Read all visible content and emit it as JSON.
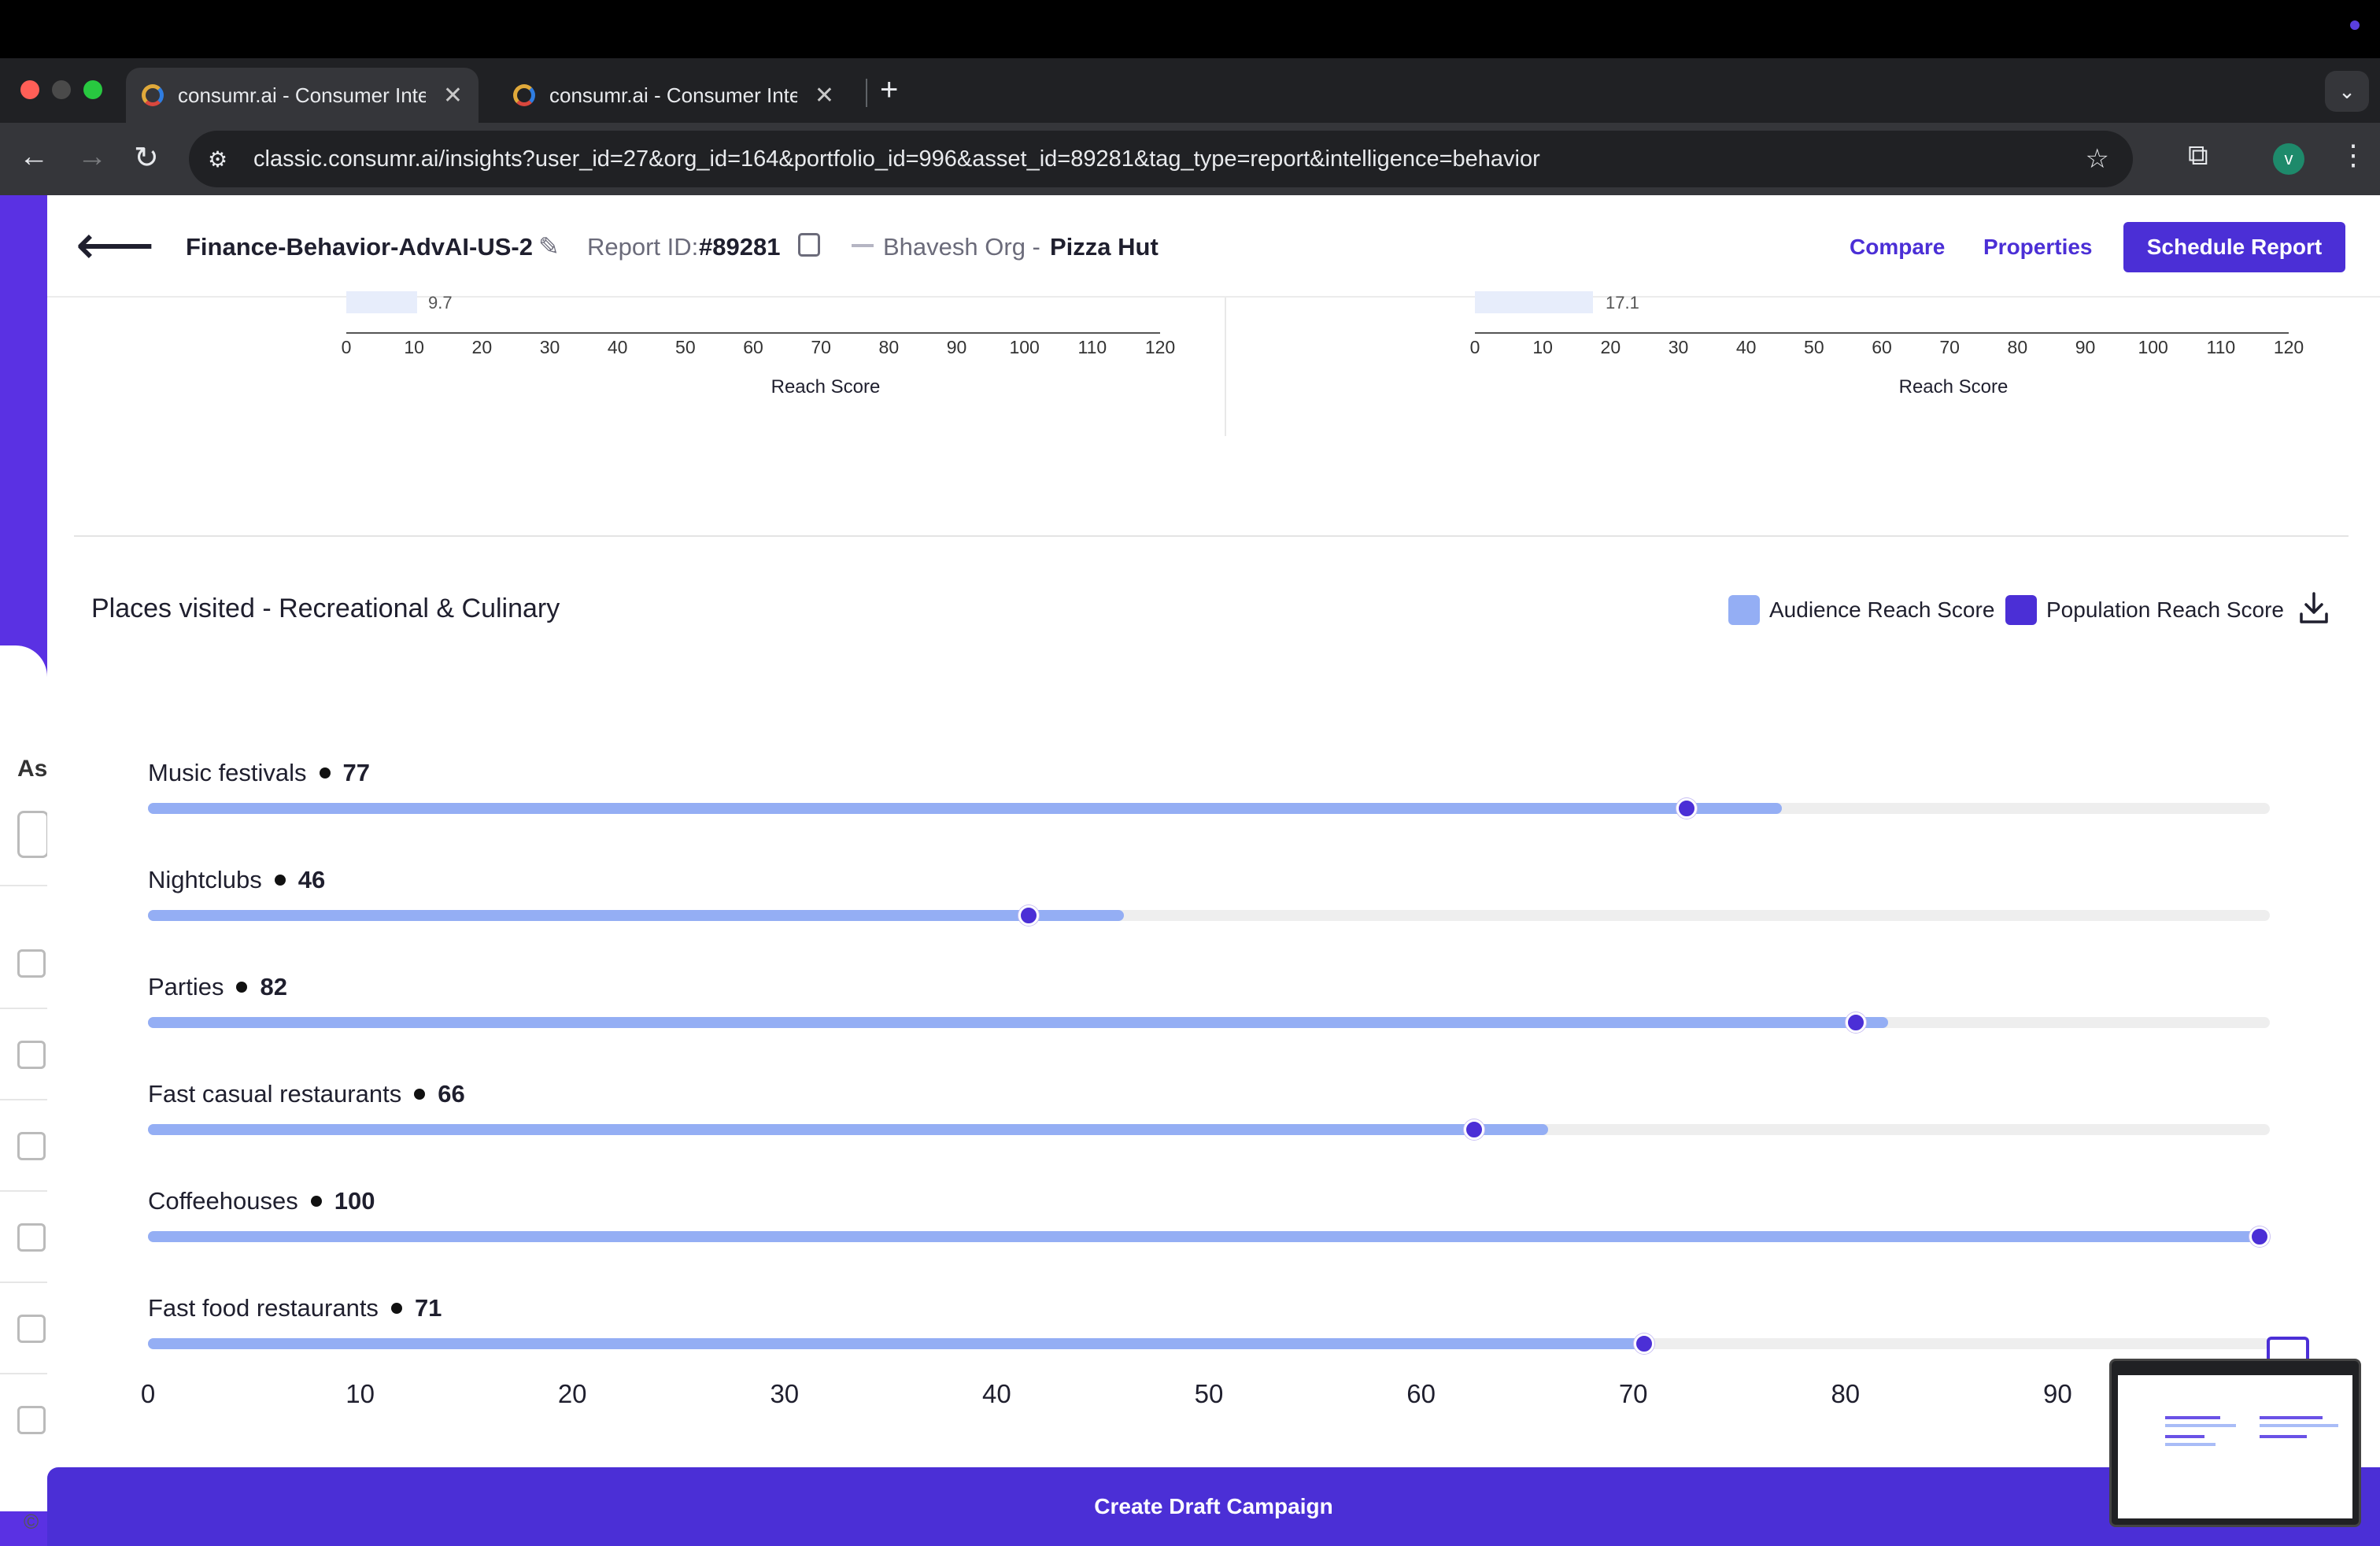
{
  "browser": {
    "tabs": [
      {
        "title": "consumr.ai - Consumer Intelli",
        "active": true
      },
      {
        "title": "consumr.ai - Consumer Intelli",
        "active": false
      }
    ],
    "url": "classic.consumr.ai/insights?user_id=27&org_id=164&portfolio_id=996&asset_id=89281&tag_type=report&intelligence=behavior",
    "profile_initial": "v"
  },
  "header": {
    "report_name": "Finance-Behavior-AdvAI-US-2",
    "report_id_label": "Report ID:",
    "report_id_value": "#89281",
    "org": "Bhavesh Org -",
    "brand": "Pizza Hut",
    "compare": "Compare",
    "properties": "Properties",
    "schedule": "Schedule Report"
  },
  "top_charts": {
    "left": {
      "last_value": "9.7",
      "xlabel": "Reach Score",
      "ticks": [
        "0",
        "10",
        "20",
        "30",
        "40",
        "50",
        "60",
        "70",
        "80",
        "90",
        "100",
        "110",
        "120"
      ]
    },
    "right": {
      "last_value": "17.1",
      "xlabel": "Reach Score",
      "ticks": [
        "0",
        "10",
        "20",
        "30",
        "40",
        "50",
        "60",
        "70",
        "80",
        "90",
        "100",
        "110",
        "120"
      ]
    }
  },
  "section": {
    "title": "Places visited - Recreational & Culinary",
    "legend": {
      "audience": "Audience Reach Score",
      "population": "Population Reach Score"
    },
    "colors": {
      "audience": "#94aef4",
      "population": "#4b2fd6",
      "track": "#eeeeee"
    }
  },
  "chart_data": {
    "type": "bar",
    "title": "Places visited - Recreational & Culinary",
    "categories": [
      "Music festivals",
      "Nightclubs",
      "Parties",
      "Fast casual restaurants",
      "Coffeehouses",
      "Fast food restaurants"
    ],
    "series": [
      {
        "name": "Audience Reach Score",
        "values": [
          77,
          46,
          82,
          66,
          100,
          71
        ]
      },
      {
        "name": "Population Reach Score",
        "values": [
          72.5,
          41.5,
          80.5,
          62.5,
          99.5,
          70.5
        ]
      }
    ],
    "xlim": [
      0,
      100
    ],
    "xticks": [
      "0",
      "10",
      "20",
      "30",
      "40",
      "50",
      "60",
      "70",
      "80",
      "90"
    ]
  },
  "footer": {
    "cta": "Create Draft Campaign"
  },
  "background": {
    "asset_label": "As",
    "footer_mark": "©"
  }
}
